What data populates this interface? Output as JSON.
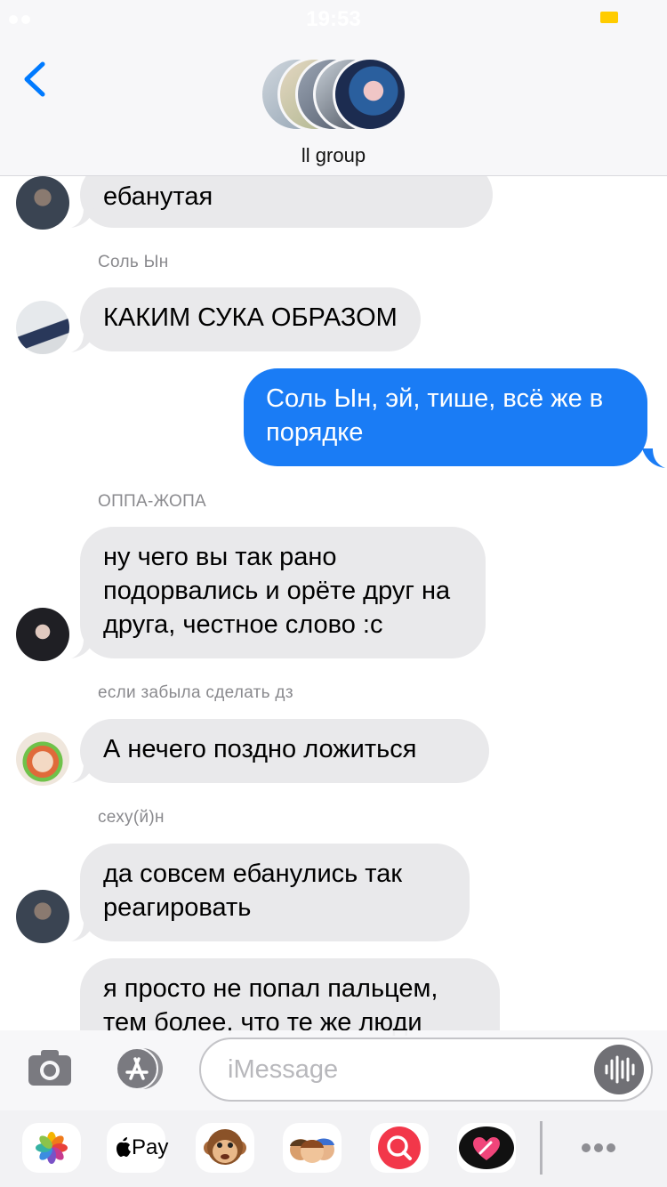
{
  "status": {
    "time": "19:53"
  },
  "header": {
    "group_name": "ll group"
  },
  "messages": [
    {
      "text": "ебанутая"
    },
    {
      "sender": "Соль Ын",
      "text": "КАКИМ СУКА ОБРАЗОМ"
    },
    {
      "text": "Соль Ын, эй, тише, всё же в порядке"
    },
    {
      "sender": "ОППА-ЖОПА",
      "text": "ну чего вы так рано подорвались и орёте друг на друга, честное слово :с"
    },
    {
      "sender": "если забыла сделать дз",
      "text": "А нечего поздно ложиться"
    },
    {
      "sender": "сеху(й)н",
      "text": "да совсем ебанулись так реагировать"
    },
    {
      "text": "я просто не попал пальцем, тем более, что те же люди"
    }
  ],
  "input": {
    "placeholder": "iMessage"
  },
  "drawer": {
    "apple_pay_label": "Pay"
  },
  "colors": {
    "outgoing": "#1a7cf5",
    "incoming": "#e9e9eb",
    "accent": "#007aff"
  },
  "icons": [
    "back-chevron-icon",
    "camera-icon",
    "app-store-icon",
    "audio-waveform-icon",
    "photos-icon",
    "apple-pay-icon",
    "animoji-monkey-icon",
    "memoji-icon",
    "image-search-icon",
    "digital-touch-icon",
    "more-icon"
  ]
}
